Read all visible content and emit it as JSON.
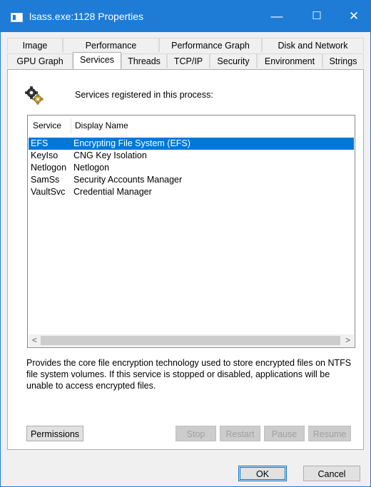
{
  "window": {
    "title": "lsass.exe:1128 Properties",
    "minimize_glyph": "—",
    "maximize_glyph": "☐",
    "close_glyph": "✕"
  },
  "tabs": {
    "row1": [
      {
        "label": "Image"
      },
      {
        "label": "Performance"
      },
      {
        "label": "Performance Graph"
      },
      {
        "label": "Disk and Network"
      }
    ],
    "row2": [
      {
        "label": "GPU Graph"
      },
      {
        "label": "Services",
        "selected": true
      },
      {
        "label": "Threads"
      },
      {
        "label": "TCP/IP"
      },
      {
        "label": "Security"
      },
      {
        "label": "Environment"
      },
      {
        "label": "Strings"
      }
    ]
  },
  "services": {
    "heading": "Services registered in this process:",
    "columns": {
      "service": "Service",
      "display": "Display Name"
    },
    "rows": [
      {
        "service": "EFS",
        "display": "Encrypting File System (EFS)",
        "selected": true
      },
      {
        "service": "KeyIso",
        "display": "CNG Key Isolation"
      },
      {
        "service": "Netlogon",
        "display": "Netlogon"
      },
      {
        "service": "SamSs",
        "display": "Security Accounts Manager"
      },
      {
        "service": "VaultSvc",
        "display": "Credential Manager"
      }
    ],
    "scroll_left": "<",
    "scroll_right": ">",
    "description": "Provides the core file encryption technology used to store encrypted files on NTFS file system volumes. If this service is stopped or disabled, applications will be unable to access encrypted files."
  },
  "buttons": {
    "permissions": "Permissions",
    "stop": "Stop",
    "restart": "Restart",
    "pause": "Pause",
    "resume": "Resume",
    "ok": "OK",
    "cancel": "Cancel"
  },
  "colors": {
    "titlebar": "#1e7bd6",
    "selection": "#0078d7"
  }
}
